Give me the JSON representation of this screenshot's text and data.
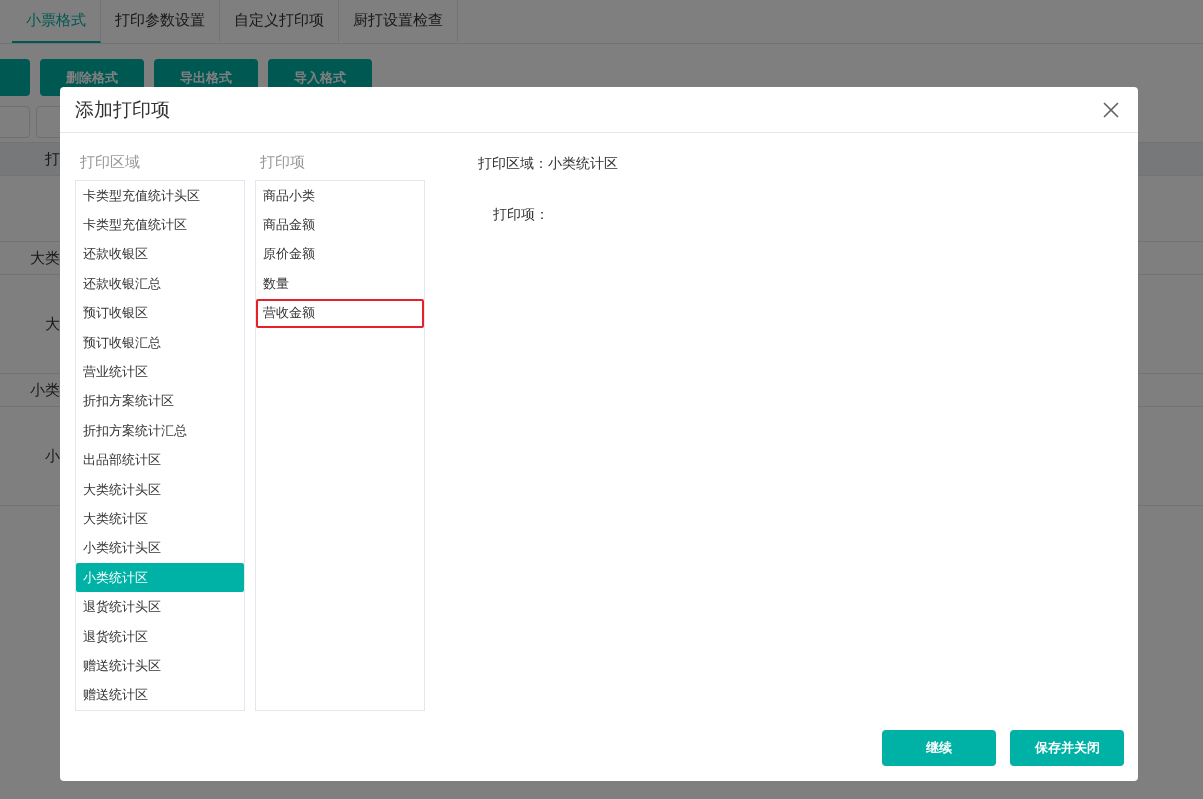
{
  "tabs": [
    {
      "label": "小票格式",
      "selected": true
    },
    {
      "label": "打印参数设置",
      "selected": false
    },
    {
      "label": "自定义打印项",
      "selected": false
    },
    {
      "label": "厨打设置检查",
      "selected": false
    }
  ],
  "toolbar_buttons": [
    "删除格式",
    "导出格式",
    "导入格式"
  ],
  "table": {
    "header": "打",
    "rows": [
      {
        "text": ""
      },
      {
        "text": "大类"
      },
      {
        "text": "大"
      },
      {
        "text": "小类"
      },
      {
        "text": "小"
      }
    ]
  },
  "dialog": {
    "title": "添加打印项",
    "area_list": {
      "label": "打印区域",
      "items": [
        {
          "label": "卡类型充值统计头区",
          "selected": false
        },
        {
          "label": "卡类型充值统计区",
          "selected": false
        },
        {
          "label": "还款收银区",
          "selected": false
        },
        {
          "label": "还款收银汇总",
          "selected": false
        },
        {
          "label": "预订收银区",
          "selected": false
        },
        {
          "label": "预订收银汇总",
          "selected": false
        },
        {
          "label": "营业统计区",
          "selected": false
        },
        {
          "label": "折扣方案统计区",
          "selected": false
        },
        {
          "label": "折扣方案统计汇总",
          "selected": false
        },
        {
          "label": "出品部统计区",
          "selected": false
        },
        {
          "label": "大类统计头区",
          "selected": false
        },
        {
          "label": "大类统计区",
          "selected": false
        },
        {
          "label": "小类统计头区",
          "selected": false
        },
        {
          "label": "小类统计区",
          "selected": true
        },
        {
          "label": "退货统计头区",
          "selected": false
        },
        {
          "label": "退货统计区",
          "selected": false
        },
        {
          "label": "赠送统计头区",
          "selected": false
        },
        {
          "label": "赠送统计区",
          "selected": false
        }
      ]
    },
    "item_list": {
      "label": "打印项",
      "items": [
        {
          "label": "商品小类",
          "selected": false
        },
        {
          "label": "商品金额",
          "selected": false
        },
        {
          "label": "原价金额",
          "selected": false
        },
        {
          "label": "数量",
          "selected": false
        },
        {
          "label": "营收金额",
          "selected": true
        }
      ]
    },
    "summary": {
      "area_label": "打印区域：",
      "area_value": "小类统计区",
      "items_label": "打印项："
    },
    "buttons": [
      "继续",
      "保存并关闭"
    ]
  }
}
